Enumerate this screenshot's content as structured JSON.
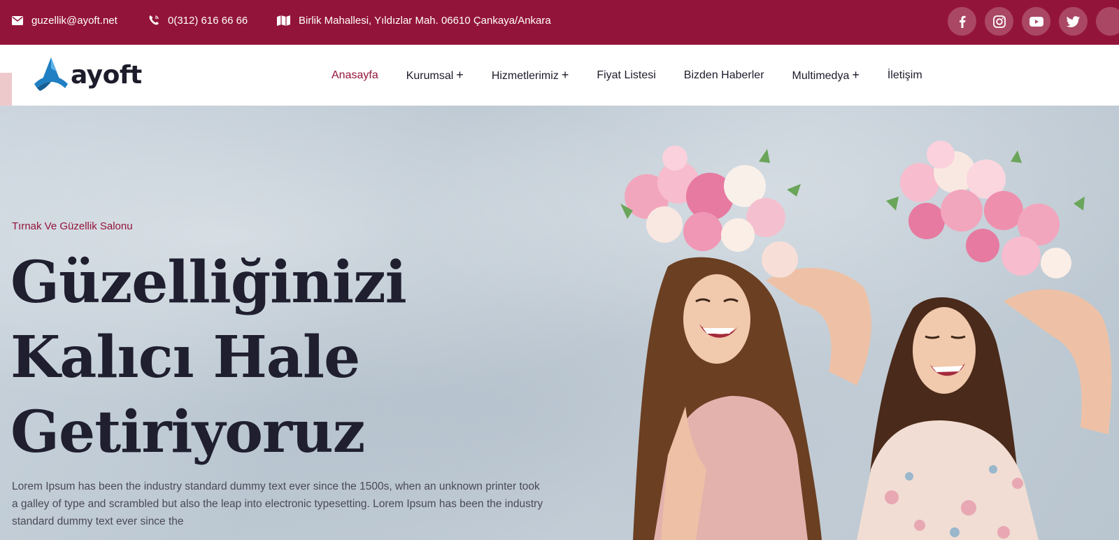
{
  "topbar": {
    "email": "guzellik@ayoft.net",
    "phone": "0(312) 616 66 66",
    "address": "Birlik Mahallesi, Yıldızlar Mah. 06610 Çankaya/Ankara",
    "socials": [
      "facebook-icon",
      "instagram-icon",
      "youtube-icon",
      "twitter-icon"
    ]
  },
  "logo": {
    "text": "ayoft"
  },
  "nav": {
    "items": [
      {
        "label": "Anasayfa",
        "plus": ""
      },
      {
        "label": "Kurumsal",
        "plus": "+"
      },
      {
        "label": "Hizmetlerimiz",
        "plus": "+"
      },
      {
        "label": "Fiyat Listesi",
        "plus": ""
      },
      {
        "label": "Bizden Haberler",
        "plus": ""
      },
      {
        "label": "Multimedya",
        "plus": "+"
      },
      {
        "label": "İletişim",
        "plus": ""
      }
    ]
  },
  "hero": {
    "kicker": "Tırnak Ve Güzellik Salonu",
    "headline": [
      "Güzelliğinizi",
      "Kalıcı Hale",
      "Getiriyoruz"
    ],
    "description": "Lorem Ipsum has been the industry standard dummy text ever since the 1500s, when an unknown printer took a galley of type and scrambled but also the leap into electronic typesetting. Lorem Ipsum has been the industry standard dummy text ever since the"
  },
  "colors": {
    "brand": "#93143a",
    "text_dark": "#1f1f30"
  }
}
